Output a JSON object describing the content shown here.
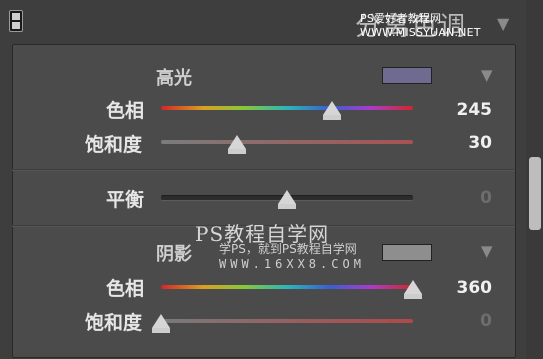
{
  "header": {
    "panel_title": "分离色调",
    "watermark_top": "PS爱好者教程网 WWW.MISSYUAN.NET"
  },
  "highlights": {
    "title": "高光",
    "swatch_color": "#6e6a90",
    "hue_label": "色相",
    "hue_value": "245",
    "hue_fraction": 0.68,
    "sat_label": "饱和度",
    "sat_value": "30",
    "sat_fraction": 0.3
  },
  "balance": {
    "label": "平衡",
    "value": "0",
    "fraction": 0.5
  },
  "shadows": {
    "title": "阴影",
    "swatch_color": "#8e8e8e",
    "hue_label": "色相",
    "hue_value": "360",
    "hue_fraction": 1.0,
    "sat_label": "饱和度",
    "sat_value": "0",
    "sat_fraction": 0.0
  },
  "watermark": {
    "line1": "PS教程自学网",
    "line2": "学PS，就到PS教程自学网",
    "line3": "WWW.16XX8.COM"
  },
  "icons": {
    "collapse": "triangle-down-icon",
    "view_toggle": "panel-toggle-icon"
  }
}
